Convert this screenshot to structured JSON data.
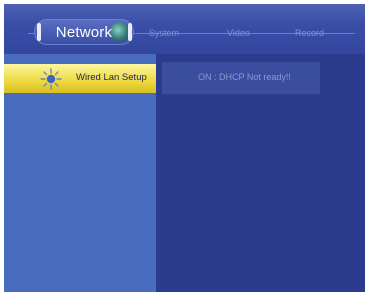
{
  "tabs": [
    {
      "label": "Network",
      "active": true
    },
    {
      "label": "System",
      "active": false
    },
    {
      "label": "Video",
      "active": false
    },
    {
      "label": "Record",
      "active": false
    }
  ],
  "menu": {
    "items": [
      {
        "label": "Wired Lan Setup",
        "icon": "sun-icon",
        "selected": true
      }
    ]
  },
  "status": {
    "text": "ON : DHCP Not ready!!"
  },
  "colors": {
    "background": "#2b3c8e",
    "menu_panel": "#4a6cbf",
    "highlight": "#efdb45",
    "tab_inactive_text": "#7f92d8"
  }
}
